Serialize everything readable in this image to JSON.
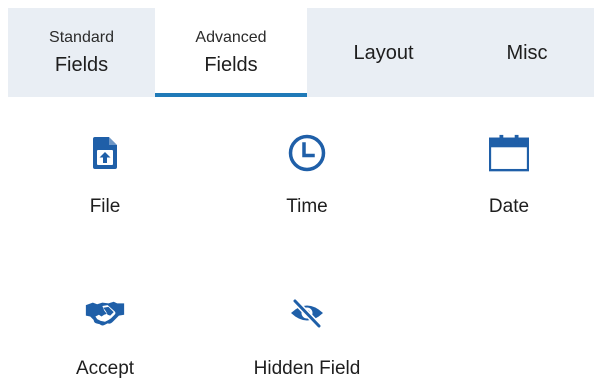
{
  "tabs": [
    {
      "top": "Standard",
      "main": "Fields"
    },
    {
      "top": "Advanced",
      "main": "Fields"
    },
    {
      "main": "Layout"
    },
    {
      "main": "Misc"
    }
  ],
  "fields": [
    {
      "label": "File",
      "icon": "file-upload-icon"
    },
    {
      "label": "Time",
      "icon": "clock-icon"
    },
    {
      "label": "Date",
      "icon": "calendar-icon"
    },
    {
      "label": "Accept",
      "icon": "handshake-icon"
    },
    {
      "label": "Hidden Field",
      "icon": "eye-slash-icon"
    }
  ],
  "colors": {
    "accent": "#1f5fa8",
    "tab_underline": "#1f7ab8",
    "tabbar_bg": "#e9eef4"
  }
}
